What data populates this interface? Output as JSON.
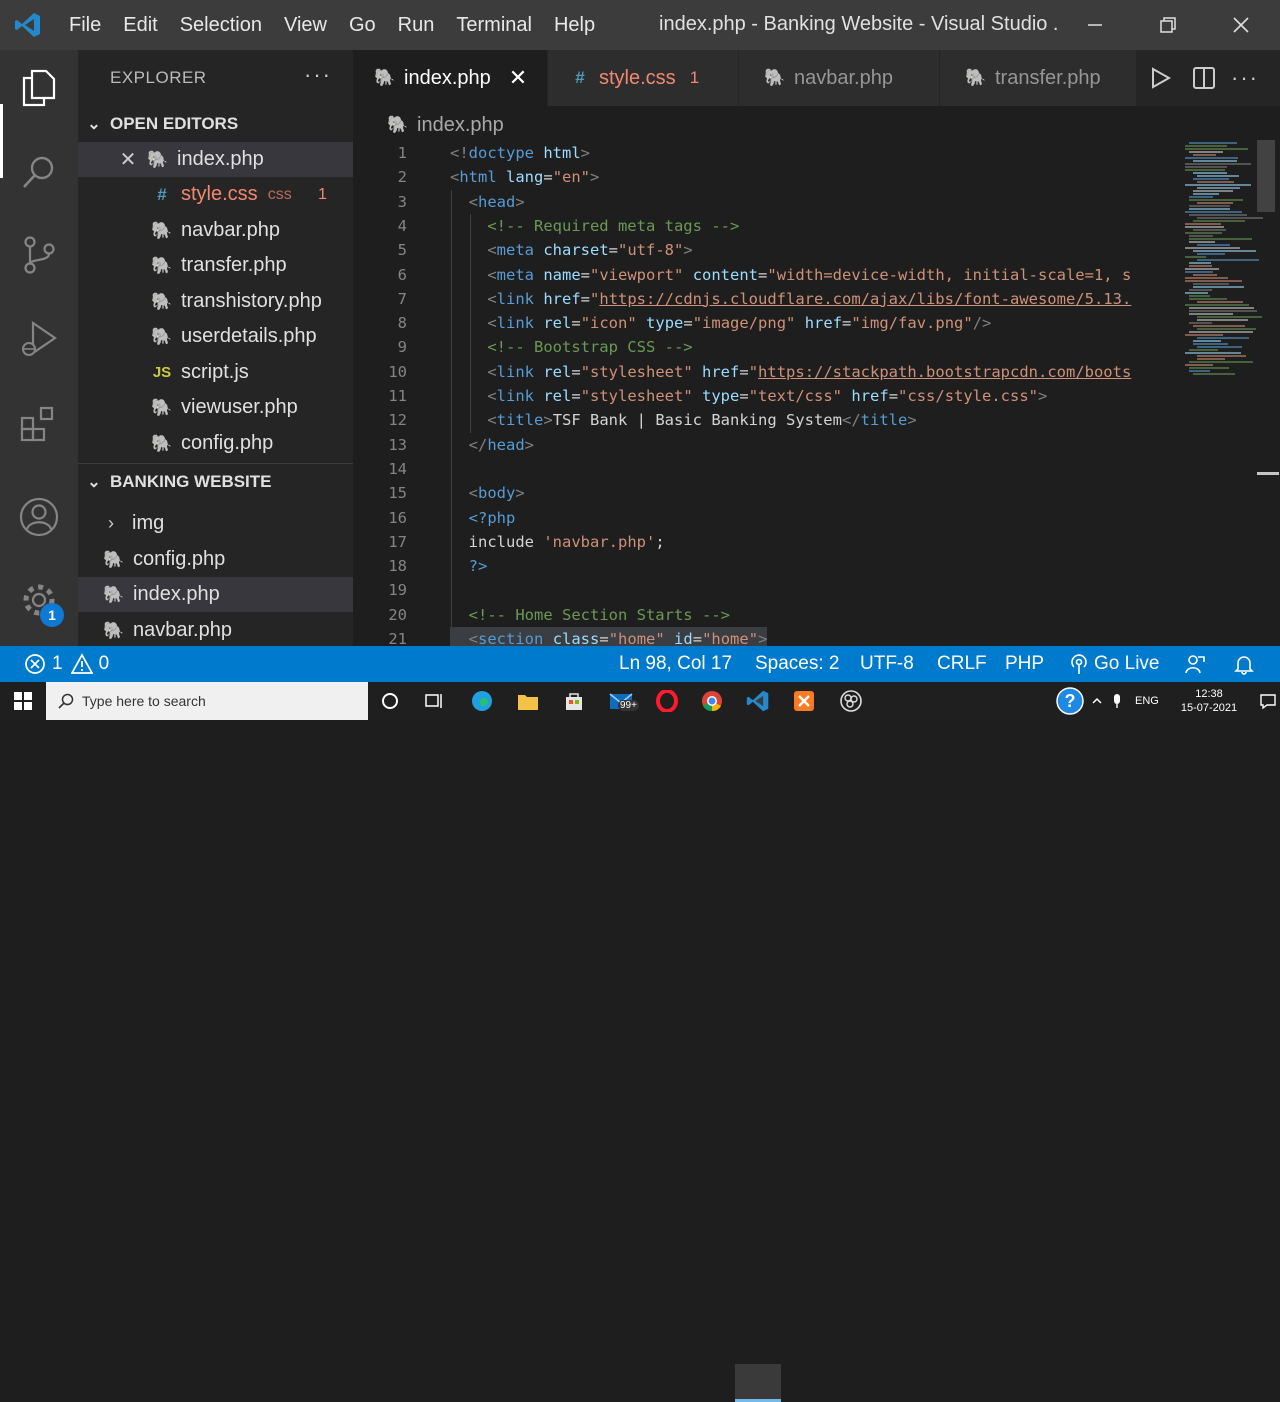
{
  "titlebar": {
    "menu": [
      "File",
      "Edit",
      "Selection",
      "View",
      "Go",
      "Run",
      "Terminal",
      "Help"
    ],
    "title": "index.php - Banking Website - Visual Studio ..."
  },
  "activity_bar": {
    "icons": [
      "files-icon",
      "search-icon",
      "source-control-icon",
      "run-debug-icon",
      "extensions-icon",
      "account-icon",
      "settings-gear-icon"
    ],
    "settings_badge": "1"
  },
  "explorer": {
    "header": "EXPLORER",
    "more": "···",
    "open_editors_title": "OPEN EDITORS",
    "open_editors": [
      {
        "name": "index.php",
        "icon": "php",
        "note": "",
        "badge": ""
      },
      {
        "name": "style.css",
        "icon": "css",
        "note": "css",
        "badge": "1"
      },
      {
        "name": "navbar.php",
        "icon": "php",
        "note": "",
        "badge": ""
      },
      {
        "name": "transfer.php",
        "icon": "php",
        "note": "",
        "badge": ""
      },
      {
        "name": "transhistory.php",
        "icon": "php",
        "note": "",
        "badge": ""
      },
      {
        "name": "userdetails.php",
        "icon": "php",
        "note": "",
        "badge": ""
      },
      {
        "name": "script.js",
        "icon": "js",
        "note": "",
        "badge": ""
      },
      {
        "name": "viewuser.php",
        "icon": "php",
        "note": "",
        "badge": ""
      },
      {
        "name": "config.php",
        "icon": "php",
        "note": "",
        "badge": ""
      }
    ],
    "workspace_title": "BANKING WEBSITE",
    "workspace": [
      {
        "name": "img",
        "type": "folder"
      },
      {
        "name": "config.php",
        "type": "php"
      },
      {
        "name": "index.php",
        "type": "php"
      },
      {
        "name": "navbar.php",
        "type": "php"
      }
    ]
  },
  "tabs": [
    {
      "label": "index.php",
      "icon": "php",
      "active": true,
      "badge": ""
    },
    {
      "label": "style.css",
      "icon": "css",
      "active": false,
      "badge": "1"
    },
    {
      "label": "navbar.php",
      "icon": "php",
      "active": false,
      "badge": ""
    },
    {
      "label": "transfer.php",
      "icon": "php",
      "active": false,
      "badge": ""
    }
  ],
  "breadcrumb": "index.php",
  "editor_lines": [
    {
      "n": "1",
      "parts": [
        [
          "br",
          "<!"
        ],
        [
          "tag",
          "doctype"
        ],
        [
          "txt",
          " "
        ],
        [
          "attr",
          "html"
        ],
        [
          "br",
          ">"
        ]
      ]
    },
    {
      "n": "2",
      "parts": [
        [
          "br",
          "<"
        ],
        [
          "tag",
          "html"
        ],
        [
          "txt",
          " "
        ],
        [
          "attr",
          "lang"
        ],
        [
          "txt",
          "="
        ],
        [
          "str",
          "\"en\""
        ],
        [
          "br",
          ">"
        ]
      ]
    },
    {
      "n": "3",
      "parts": [
        [
          "txt",
          "  "
        ],
        [
          "br",
          "<"
        ],
        [
          "tag",
          "head"
        ],
        [
          "br",
          ">"
        ]
      ]
    },
    {
      "n": "4",
      "parts": [
        [
          "txt",
          "    "
        ],
        [
          "com",
          "<!-- Required meta tags -->"
        ]
      ]
    },
    {
      "n": "5",
      "parts": [
        [
          "txt",
          "    "
        ],
        [
          "br",
          "<"
        ],
        [
          "tag",
          "meta"
        ],
        [
          "txt",
          " "
        ],
        [
          "attr",
          "charset"
        ],
        [
          "txt",
          "="
        ],
        [
          "str",
          "\"utf-8\""
        ],
        [
          "br",
          ">"
        ]
      ]
    },
    {
      "n": "6",
      "parts": [
        [
          "txt",
          "    "
        ],
        [
          "br",
          "<"
        ],
        [
          "tag",
          "meta"
        ],
        [
          "txt",
          " "
        ],
        [
          "attr",
          "name"
        ],
        [
          "txt",
          "="
        ],
        [
          "str",
          "\"viewport\""
        ],
        [
          "txt",
          " "
        ],
        [
          "attr",
          "content"
        ],
        [
          "txt",
          "="
        ],
        [
          "str",
          "\"width=device-width, initial-scale=1, s"
        ]
      ]
    },
    {
      "n": "7",
      "parts": [
        [
          "txt",
          "    "
        ],
        [
          "br",
          "<"
        ],
        [
          "tag",
          "link"
        ],
        [
          "txt",
          " "
        ],
        [
          "attr",
          "href"
        ],
        [
          "txt",
          "="
        ],
        [
          "str",
          "\""
        ],
        [
          "url",
          "https://cdnjs.cloudflare.com/ajax/libs/font-awesome/5.13."
        ]
      ]
    },
    {
      "n": "8",
      "parts": [
        [
          "txt",
          "    "
        ],
        [
          "br",
          "<"
        ],
        [
          "tag",
          "link"
        ],
        [
          "txt",
          " "
        ],
        [
          "attr",
          "rel"
        ],
        [
          "txt",
          "="
        ],
        [
          "str",
          "\"icon\""
        ],
        [
          "txt",
          " "
        ],
        [
          "attr",
          "type"
        ],
        [
          "txt",
          "="
        ],
        [
          "str",
          "\"image/png\""
        ],
        [
          "txt",
          " "
        ],
        [
          "attr",
          "href"
        ],
        [
          "txt",
          "="
        ],
        [
          "str",
          "\"img/fav.png\""
        ],
        [
          "br",
          "/>"
        ]
      ]
    },
    {
      "n": "9",
      "parts": [
        [
          "txt",
          "    "
        ],
        [
          "com",
          "<!-- Bootstrap CSS -->"
        ]
      ]
    },
    {
      "n": "10",
      "parts": [
        [
          "txt",
          "    "
        ],
        [
          "br",
          "<"
        ],
        [
          "tag",
          "link"
        ],
        [
          "txt",
          " "
        ],
        [
          "attr",
          "rel"
        ],
        [
          "txt",
          "="
        ],
        [
          "str",
          "\"stylesheet\""
        ],
        [
          "txt",
          " "
        ],
        [
          "attr",
          "href"
        ],
        [
          "txt",
          "="
        ],
        [
          "str",
          "\""
        ],
        [
          "url",
          "https://stackpath.bootstrapcdn.com/boots"
        ]
      ]
    },
    {
      "n": "11",
      "parts": [
        [
          "txt",
          "    "
        ],
        [
          "br",
          "<"
        ],
        [
          "tag",
          "link"
        ],
        [
          "txt",
          " "
        ],
        [
          "attr",
          "rel"
        ],
        [
          "txt",
          "="
        ],
        [
          "str",
          "\"stylesheet\""
        ],
        [
          "txt",
          " "
        ],
        [
          "attr",
          "type"
        ],
        [
          "txt",
          "="
        ],
        [
          "str",
          "\"text/css\""
        ],
        [
          "txt",
          " "
        ],
        [
          "attr",
          "href"
        ],
        [
          "txt",
          "="
        ],
        [
          "str",
          "\"css/style.css\""
        ],
        [
          "br",
          ">"
        ]
      ]
    },
    {
      "n": "12",
      "parts": [
        [
          "txt",
          "    "
        ],
        [
          "br",
          "<"
        ],
        [
          "tag",
          "title"
        ],
        [
          "br",
          ">"
        ],
        [
          "txt",
          "TSF Bank | Basic Banking System"
        ],
        [
          "br",
          "</"
        ],
        [
          "tag",
          "title"
        ],
        [
          "br",
          ">"
        ]
      ]
    },
    {
      "n": "13",
      "parts": [
        [
          "txt",
          "  "
        ],
        [
          "br",
          "</"
        ],
        [
          "tag",
          "head"
        ],
        [
          "br",
          ">"
        ]
      ]
    },
    {
      "n": "14",
      "parts": []
    },
    {
      "n": "15",
      "parts": [
        [
          "txt",
          "  "
        ],
        [
          "br",
          "<"
        ],
        [
          "tag",
          "body"
        ],
        [
          "br",
          ">"
        ]
      ]
    },
    {
      "n": "16",
      "parts": [
        [
          "txt",
          "  "
        ],
        [
          "php",
          "<?php"
        ]
      ]
    },
    {
      "n": "17",
      "parts": [
        [
          "txt",
          "  include "
        ],
        [
          "str",
          "'navbar.php'"
        ],
        [
          "txt",
          ";"
        ]
      ]
    },
    {
      "n": "18",
      "parts": [
        [
          "txt",
          "  "
        ],
        [
          "php",
          "?>"
        ]
      ]
    },
    {
      "n": "19",
      "parts": []
    },
    {
      "n": "20",
      "parts": [
        [
          "txt",
          "  "
        ],
        [
          "com",
          "<!-- Home Section Starts -->"
        ]
      ]
    },
    {
      "n": "21",
      "parts": [
        [
          "txt",
          "  "
        ],
        [
          "br",
          "<"
        ],
        [
          "tag",
          "section"
        ],
        [
          "txt",
          " "
        ],
        [
          "attr",
          "class"
        ],
        [
          "txt",
          "="
        ],
        [
          "str",
          "\"home\""
        ],
        [
          "txt",
          " "
        ],
        [
          "attr",
          "id"
        ],
        [
          "txt",
          "="
        ],
        [
          "str",
          "\"home\""
        ],
        [
          "br",
          ">"
        ]
      ]
    }
  ],
  "status_bar": {
    "errors": "1",
    "warnings": "0",
    "position": "Ln 98, Col 17",
    "spaces": "Spaces: 2",
    "encoding": "UTF-8",
    "eol": "CRLF",
    "language": "PHP",
    "go_live": "Go Live"
  },
  "taskbar": {
    "search_placeholder": "Type here to search",
    "mail_badge": "99+",
    "language": "ENG",
    "time": "12:38",
    "date": "15-07-2021"
  },
  "colors": {
    "accent": "#007acc",
    "php_icon": "#a074c4",
    "css_icon": "#519aba",
    "error_text": "#f48771"
  }
}
